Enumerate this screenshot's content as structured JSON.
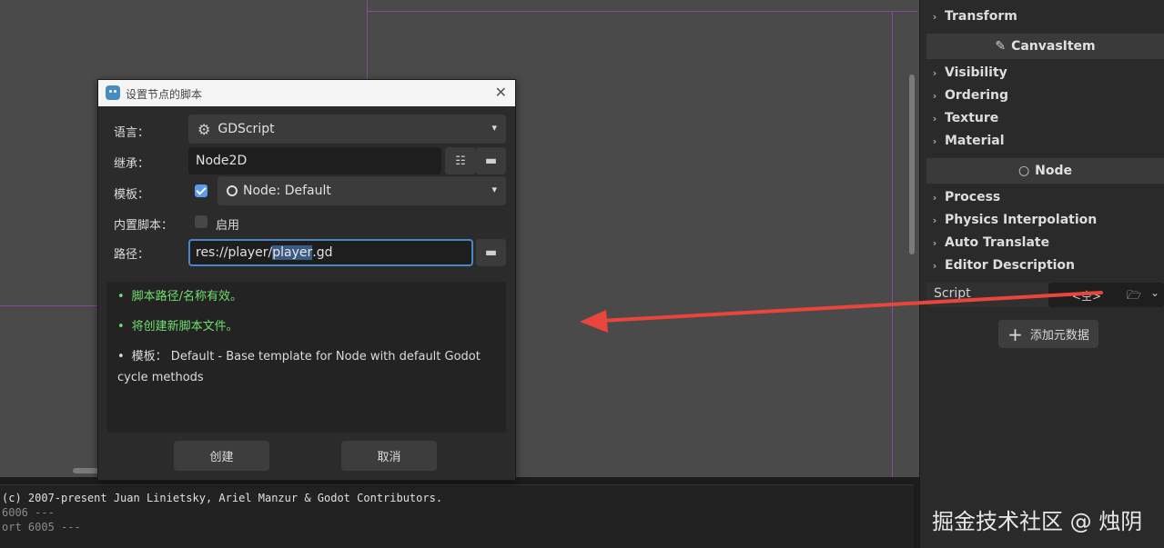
{
  "dialog": {
    "title": "设置节点的脚本",
    "close_glyph": "✕",
    "language": {
      "label": "语言：",
      "value": "GDScript"
    },
    "inherits": {
      "label": "继承：",
      "value": "Node2D"
    },
    "template": {
      "label": "模板：",
      "checked": true,
      "value": "Node: Default"
    },
    "builtin": {
      "label": "内置脚本：",
      "checked": false,
      "option": "启用"
    },
    "path": {
      "label": "路径：",
      "prefix": "res://player/",
      "selected": "player",
      "suffix": ".gd"
    },
    "messages": [
      {
        "text": "脚本路径/名称有效。",
        "color": "green"
      },
      {
        "text": "将创建新脚本文件。",
        "color": "green"
      },
      {
        "text": "模板： Default - Base template for Node with default Godot cycle methods",
        "color": "white"
      }
    ],
    "create_button": "创建",
    "cancel_button": "取消"
  },
  "inspector": {
    "sections": {
      "transform": "Transform",
      "canvas_item": "CanvasItem",
      "visibility": "Visibility",
      "ordering": "Ordering",
      "texture": "Texture",
      "material": "Material",
      "node": "Node",
      "process": "Process",
      "physics_interpolation": "Physics Interpolation",
      "auto_translate": "Auto Translate",
      "editor_description": "Editor Description"
    },
    "script": {
      "label": "Script",
      "value": "<空>"
    },
    "add_metadata": "添加元数据"
  },
  "console": {
    "lines": [
      "(c) 2007-present Juan Linietsky, Ariel Manzur & Godot Contributors.",
      "6006 ---",
      "ort 6005 ---"
    ]
  },
  "watermark": "掘金技术社区 @ 烛阴",
  "colors": {
    "accent": "#4a86c7",
    "valid_message": "#6fe06f",
    "annotation_arrow": "#e8453c",
    "guide_lines": "#8a4a9e"
  }
}
